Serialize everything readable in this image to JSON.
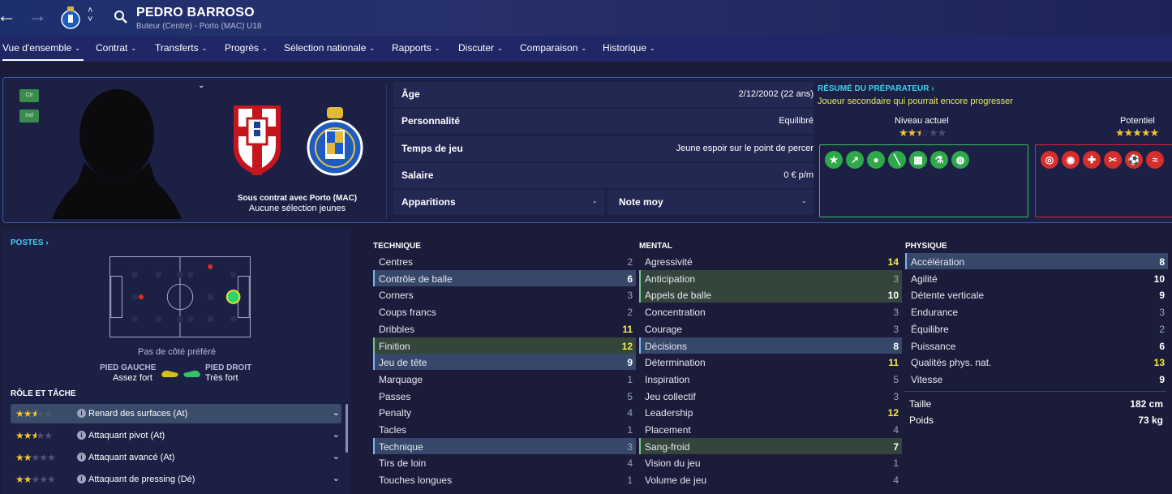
{
  "header": {
    "player_name": "PEDRO BARROSO",
    "subtitle": "Buteur (Centre) - Porto (MAC) U18",
    "icons": [
      "back-arrow-icon",
      "forward-arrow-icon",
      "club-crest-icon",
      "up-down-icon",
      "search-icon"
    ]
  },
  "tabs": [
    {
      "label": "Vue d'ensemble",
      "active": true
    },
    {
      "label": "Contrat"
    },
    {
      "label": "Transferts"
    },
    {
      "label": "Progrès"
    },
    {
      "label": "Sélection nationale"
    },
    {
      "label": "Rapports"
    },
    {
      "label": "Discuter"
    },
    {
      "label": "Comparaison"
    },
    {
      "label": "Historique"
    }
  ],
  "profile": {
    "badges": [
      "Ctr",
      "Ind"
    ],
    "contract_line1": "Sous contrat avec Porto (MAC)",
    "contract_line2": "Aucune sélection jeunes"
  },
  "info": {
    "age_label": "Âge",
    "age_value": "2/12/2002 (22 ans)",
    "personality_label": "Personnalité",
    "personality_value": "Equilibré",
    "playtime_label": "Temps de jeu",
    "playtime_value": "Jeune espoir sur le point de percer",
    "salary_label": "Salaire",
    "salary_value": "0 € p/m",
    "appearances_label": "Apparitions",
    "appearances_value": "-",
    "rating_label": "Note moy",
    "rating_value": "-"
  },
  "coach": {
    "title": "RÉSUMÉ DU PRÉPARATEUR ›",
    "text": "Joueur secondaire qui pourrait encore progresser",
    "current_label": "Niveau actuel",
    "current_stars": 2.5,
    "potential_label": "Potentiel",
    "potential_stars": 5,
    "strength_icons": [
      "star-icon",
      "trend-up-icon",
      "brain-icon",
      "boot-icon",
      "gear-chart-icon",
      "flask-icon",
      "globe-icon"
    ],
    "weakness_icons": [
      "target-icon",
      "eye-icon",
      "medical-cross-icon",
      "scissors-icon",
      "ball-icon",
      "tackle-icon"
    ]
  },
  "left": {
    "positions_title": "POSTES ›",
    "pref_side": "Pas de côté préféré",
    "left_foot_title": "PIED GAUCHE",
    "left_foot_value": "Assez fort",
    "right_foot_title": "PIED DROIT",
    "right_foot_value": "Très fort",
    "role_title": "RÔLE ET TÂCHE",
    "roles": [
      {
        "stars": 2.5,
        "name": "Renard des surfaces (At)",
        "active": true
      },
      {
        "stars": 2.5,
        "name": "Attaquant pivot (At)"
      },
      {
        "stars": 2,
        "name": "Attaquant avancé (At)"
      },
      {
        "stars": 2,
        "name": "Attaquant de pressing (Dé)"
      }
    ]
  },
  "technique": {
    "title": "TECHNIQUE",
    "items": [
      {
        "name": "Centres",
        "value": "2"
      },
      {
        "name": "Contrôle de balle",
        "value": "6",
        "hl": "blue"
      },
      {
        "name": "Corners",
        "value": "3"
      },
      {
        "name": "Coups francs",
        "value": "2"
      },
      {
        "name": "Dribbles",
        "value": "11"
      },
      {
        "name": "Finition",
        "value": "12",
        "hl": "green"
      },
      {
        "name": "Jeu de tête",
        "value": "9",
        "hl": "blue"
      },
      {
        "name": "Marquage",
        "value": "1"
      },
      {
        "name": "Passes",
        "value": "5"
      },
      {
        "name": "Penalty",
        "value": "4"
      },
      {
        "name": "Tacles",
        "value": "1"
      },
      {
        "name": "Technique",
        "value": "3",
        "hl": "blue"
      },
      {
        "name": "Tirs de loin",
        "value": "4"
      },
      {
        "name": "Touches longues",
        "value": "1"
      }
    ]
  },
  "mental": {
    "title": "MENTAL",
    "items": [
      {
        "name": "Agressivité",
        "value": "14"
      },
      {
        "name": "Anticipation",
        "value": "3",
        "hl": "green"
      },
      {
        "name": "Appels de balle",
        "value": "10",
        "hl": "green"
      },
      {
        "name": "Concentration",
        "value": "3"
      },
      {
        "name": "Courage",
        "value": "3"
      },
      {
        "name": "Décisions",
        "value": "8",
        "hl": "blue"
      },
      {
        "name": "Détermination",
        "value": "11"
      },
      {
        "name": "Inspiration",
        "value": "5"
      },
      {
        "name": "Jeu collectif",
        "value": "3"
      },
      {
        "name": "Leadership",
        "value": "12"
      },
      {
        "name": "Placement",
        "value": "4"
      },
      {
        "name": "Sang-froid",
        "value": "7",
        "hl": "green"
      },
      {
        "name": "Vision du jeu",
        "value": "1"
      },
      {
        "name": "Volume de jeu",
        "value": "4"
      }
    ]
  },
  "physique": {
    "title": "PHYSIQUE",
    "items": [
      {
        "name": "Accélération",
        "value": "8",
        "hl": "blue"
      },
      {
        "name": "Agilité",
        "value": "10"
      },
      {
        "name": "Détente verticale",
        "value": "9"
      },
      {
        "name": "Endurance",
        "value": "3"
      },
      {
        "name": "Équilibre",
        "value": "2"
      },
      {
        "name": "Puissance",
        "value": "6"
      },
      {
        "name": "Qualités phys. nat.",
        "value": "13"
      },
      {
        "name": "Vitesse",
        "value": "9"
      }
    ],
    "height_label": "Taille",
    "height_value": "182 cm",
    "weight_label": "Poids",
    "weight_value": "73 kg"
  },
  "colors": {
    "accent_cyan": "#40d0f0",
    "attr_yellow": "#f6e94a",
    "strength_green": "#3bc25a",
    "weakness_red": "#d42a2a"
  }
}
